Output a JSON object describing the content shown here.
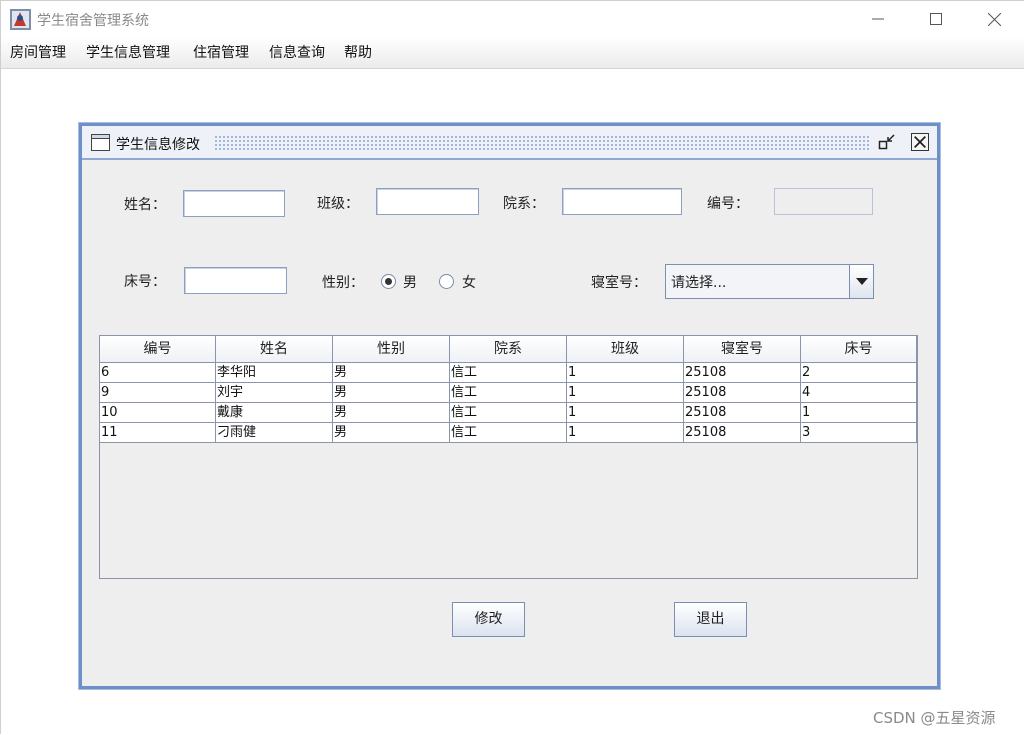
{
  "window": {
    "title": "学生宿舍管理系统",
    "controls": {
      "minimize": "—",
      "maximize": "☐",
      "close": "✕"
    }
  },
  "menu": {
    "items": [
      {
        "label": "房间管理"
      },
      {
        "label": "学生信息管理"
      },
      {
        "label": "住宿管理"
      },
      {
        "label": "信息查询"
      },
      {
        "label": "帮助"
      }
    ]
  },
  "dialog": {
    "title": "学生信息修改",
    "form": {
      "name_label": "姓名：",
      "name_value": "",
      "class_label": "班级：",
      "class_value": "",
      "department_label": "院系：",
      "department_value": "",
      "id_label": "编号：",
      "id_value": "",
      "bed_label": "床号：",
      "bed_value": "",
      "gender_label": "性别：",
      "gender_options": [
        {
          "label": "男",
          "checked": true
        },
        {
          "label": "女",
          "checked": false
        }
      ],
      "dorm_label": "寝室号：",
      "dorm_selected": "请选择..."
    },
    "table": {
      "columns": [
        "编号",
        "姓名",
        "性别",
        "院系",
        "班级",
        "寝室号",
        "床号"
      ],
      "rows": [
        [
          "6",
          "李华阳",
          "男",
          "信工",
          "1",
          "25108",
          "2"
        ],
        [
          "9",
          "刘宇",
          "男",
          "信工",
          "1",
          "25108",
          "4"
        ],
        [
          "10",
          "戴康",
          "男",
          "信工",
          "1",
          "25108",
          "1"
        ],
        [
          "11",
          "刁雨健",
          "男",
          "信工",
          "1",
          "25108",
          "3"
        ]
      ]
    },
    "buttons": {
      "modify": "修改",
      "exit": "退出"
    }
  },
  "watermark": "CSDN @五星资源",
  "colors": {
    "frame_border": "#6e8fc8",
    "panel_bg": "#eeeeee"
  }
}
